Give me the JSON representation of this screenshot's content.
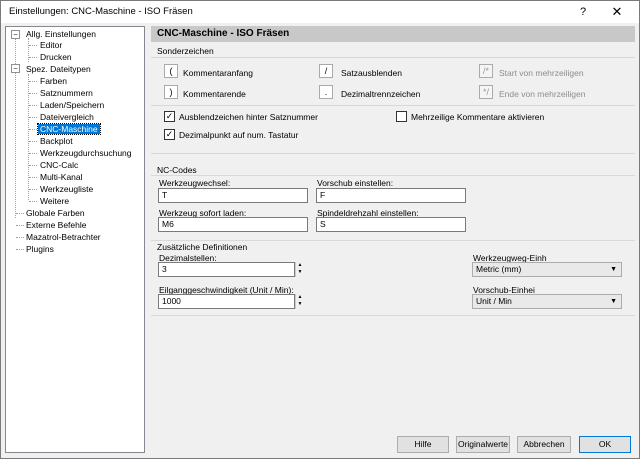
{
  "window": {
    "title": "Einstellungen: CNC-Maschine - ISO Fräsen",
    "help": "?",
    "close": "✕"
  },
  "tree": {
    "items": [
      {
        "label": "Allg. Einstellungen",
        "toggle": "−"
      },
      {
        "label": "Editor"
      },
      {
        "label": "Drucken"
      },
      {
        "label": "Spez. Dateitypen",
        "toggle": "−"
      },
      {
        "label": "Farben"
      },
      {
        "label": "Satznummern"
      },
      {
        "label": "Laden/Speichern"
      },
      {
        "label": "Dateivergleich"
      },
      {
        "label": "CNC-Maschine"
      },
      {
        "label": "Backplot"
      },
      {
        "label": "Werkzeugdurchsuchung"
      },
      {
        "label": "CNC-Calc"
      },
      {
        "label": "Multi-Kanal"
      },
      {
        "label": "Werkzeugliste"
      },
      {
        "label": "Weitere"
      },
      {
        "label": "Globale Farben"
      },
      {
        "label": "Externe Befehle"
      },
      {
        "label": "Mazatrol-Betrachter"
      },
      {
        "label": "Plugins"
      }
    ]
  },
  "header": {
    "title": "CNC-Maschine - ISO Fräsen"
  },
  "sonderzeichen": {
    "title": "Sonderzeichen",
    "items": [
      {
        "key": "(",
        "label": "Kommentaranfang"
      },
      {
        "key": ")",
        "label": "Kommentarende"
      },
      {
        "key": "/",
        "label": "Satzausblenden"
      },
      {
        "key": ".",
        "label": "Dezimaltrennzeichen"
      },
      {
        "key": "/*",
        "label": "Start von mehrzeiligen"
      },
      {
        "key": "*/",
        "label": "Ende von mehrzeiligen"
      }
    ],
    "cb_ausblend": "Ausblendzeichen hinter Satznummer",
    "cb_dezimal": "Dezimalpunkt auf num. Tastatur",
    "cb_mehrzeilig": "Mehrzeilige Kommentare aktivieren",
    "check": "✓"
  },
  "nc_codes": {
    "title": "NC-Codes",
    "werkzeugwechsel_label": "Werkzeugwechsel:",
    "werkzeugwechsel_value": "T",
    "vorschub_label": "Vorschub einstellen:",
    "vorschub_value": "F",
    "werkzeug_sofort_label": "Werkzeug sofort laden:",
    "werkzeug_sofort_value": "M6",
    "spindel_label": "Spindeldrehzahl einstellen:",
    "spindel_value": "S"
  },
  "zusaetzlich": {
    "title": "Zusätzliche Definitionen",
    "dezimalstellen_label": "Dezimalstellen:",
    "dezimalstellen_value": "3",
    "eilgang_label": "Eilganggeschwindigkeit (Unit / Min):",
    "eilgang_value": "1000",
    "werkzeugweg_label": "Werkzeugweg-Einh",
    "werkzeugweg_value": "Metric (mm)",
    "vorschub_einheit_label": "Vorschub-Einhei",
    "vorschub_einheit_value": "Unit / Min"
  },
  "buttons": {
    "hilfe": "Hilfe",
    "original": "Originalwerte",
    "abbrechen": "Abbrechen",
    "ok": "OK"
  }
}
